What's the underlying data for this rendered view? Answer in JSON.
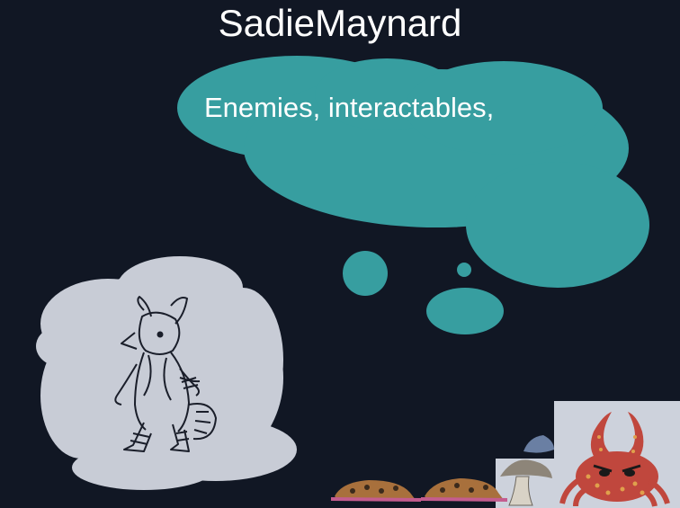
{
  "title": "SadieMaynard",
  "speech": "Enemies, interactables,",
  "colors": {
    "background": "#111724",
    "bubble": "#379ea0",
    "cloud": "#c8ccd6",
    "panel": "#cdd2dc"
  },
  "sprites": [
    "character-sketch-icon",
    "slug-icon",
    "slug-icon",
    "rock-icon",
    "mushroom-icon",
    "crab-enemy-icon"
  ]
}
